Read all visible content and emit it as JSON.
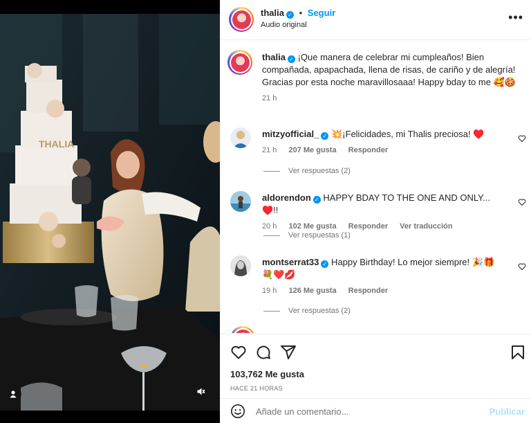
{
  "post": {
    "username": "thalia",
    "follow_label": "Seguir",
    "audio_label": "Audio original",
    "caption": "¡Que manera de celebrar mi cumpleaños! Bien compañada, apapachada, llena de risas, de cariño y de alegría! Gracias por esta noche maravillosaaa! Happy bday to me 🥰🍪",
    "caption_time": "21 h",
    "cake_text": "THALIA",
    "likes": "103,762 Me gusta",
    "time_ago": "HACE 21 HORAS",
    "comment_placeholder": "Añade un comentario...",
    "publish_label": "Publicar"
  },
  "comments": [
    {
      "username": "mitzyofficial_",
      "text": "💥¡Felicidades, mi Thalis preciosa! ♥️",
      "time": "21 h",
      "likes": "207 Me gusta",
      "reply_label": "Responder",
      "replies": "Ver respuestas (2)"
    },
    {
      "username": "aldorendon",
      "text": "HAPPY BDAY TO THE ONE AND ONLY... ♥️!!",
      "time": "20 h",
      "likes": "102 Me gusta",
      "reply_label": "Responder",
      "translate_label": "Ver traducción",
      "replies": "Ver respuestas (1)"
    },
    {
      "username": "montserrat33",
      "text": "Happy Birthday! Lo mejor siempre! 🎉🎁 💐❤️💋",
      "time": "19 h",
      "likes": "126 Me gusta",
      "reply_label": "Responder",
      "replies": "Ver respuestas (2)"
    }
  ],
  "icons": {
    "more": "more-options-icon",
    "like": "heart-icon",
    "comment": "comment-icon",
    "share": "share-icon",
    "save": "bookmark-icon",
    "emoji": "emoji-icon",
    "user_tag": "user-tag-icon",
    "mute": "mute-icon"
  },
  "colors": {
    "accent": "#0095f6",
    "publish_disabled": "#b2dffc",
    "muted": "#737373"
  }
}
